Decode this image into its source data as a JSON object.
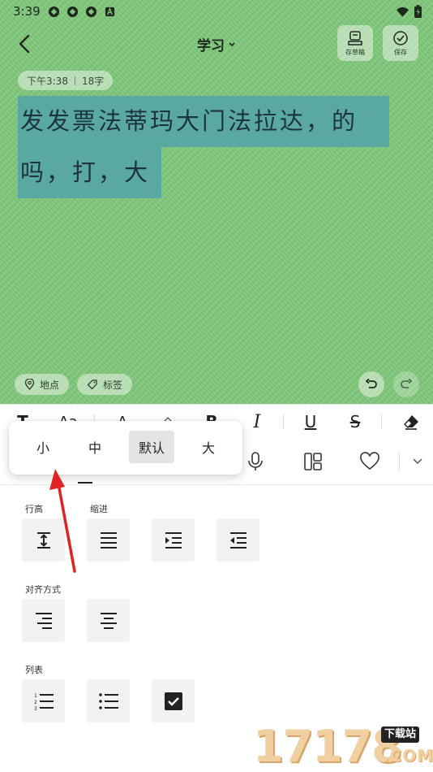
{
  "status_bar": {
    "time": "3:39",
    "left_icons": [
      "app-icon",
      "app-icon",
      "app-icon",
      "notification-a-icon"
    ],
    "right_icons": [
      "wifi-icon",
      "battery-icon"
    ]
  },
  "header": {
    "title": "学习",
    "draft_label": "存草稿",
    "save_label": "保存"
  },
  "note": {
    "time": "下午3:38",
    "char_count": "18字",
    "line1": "发发票法蒂玛大门法拉达，的",
    "line2": "吗，打，大",
    "location_label": "地点",
    "tag_label": "标签"
  },
  "format_toolbar": {
    "items": [
      {
        "name": "text-size-icon",
        "glyph": "T"
      },
      {
        "name": "font-style-icon",
        "glyph": "Aa"
      },
      {
        "name": "font-color-icon",
        "glyph": "A"
      },
      {
        "name": "highlight-icon",
        "glyph": "◇"
      },
      {
        "name": "bold-icon",
        "glyph": "B"
      },
      {
        "name": "italic-icon",
        "glyph": "I"
      },
      {
        "name": "underline-icon",
        "glyph": "U"
      },
      {
        "name": "strikethrough-icon",
        "glyph": "S"
      },
      {
        "name": "eraser-icon",
        "glyph": ""
      }
    ]
  },
  "size_popup": {
    "options": [
      "小",
      "中",
      "默认",
      "大"
    ],
    "selected": "默认"
  },
  "panel": {
    "line_height_label": "行高",
    "indent_label": "缩进",
    "align_label": "对齐方式",
    "list_label": "列表"
  },
  "watermark": {
    "digits": "17178",
    "tag": "下载站",
    "domain": ".COM"
  },
  "colors": {
    "note_bg": "#7fc87a",
    "selection": "#5aa8a2",
    "arrow": "#e02424"
  }
}
